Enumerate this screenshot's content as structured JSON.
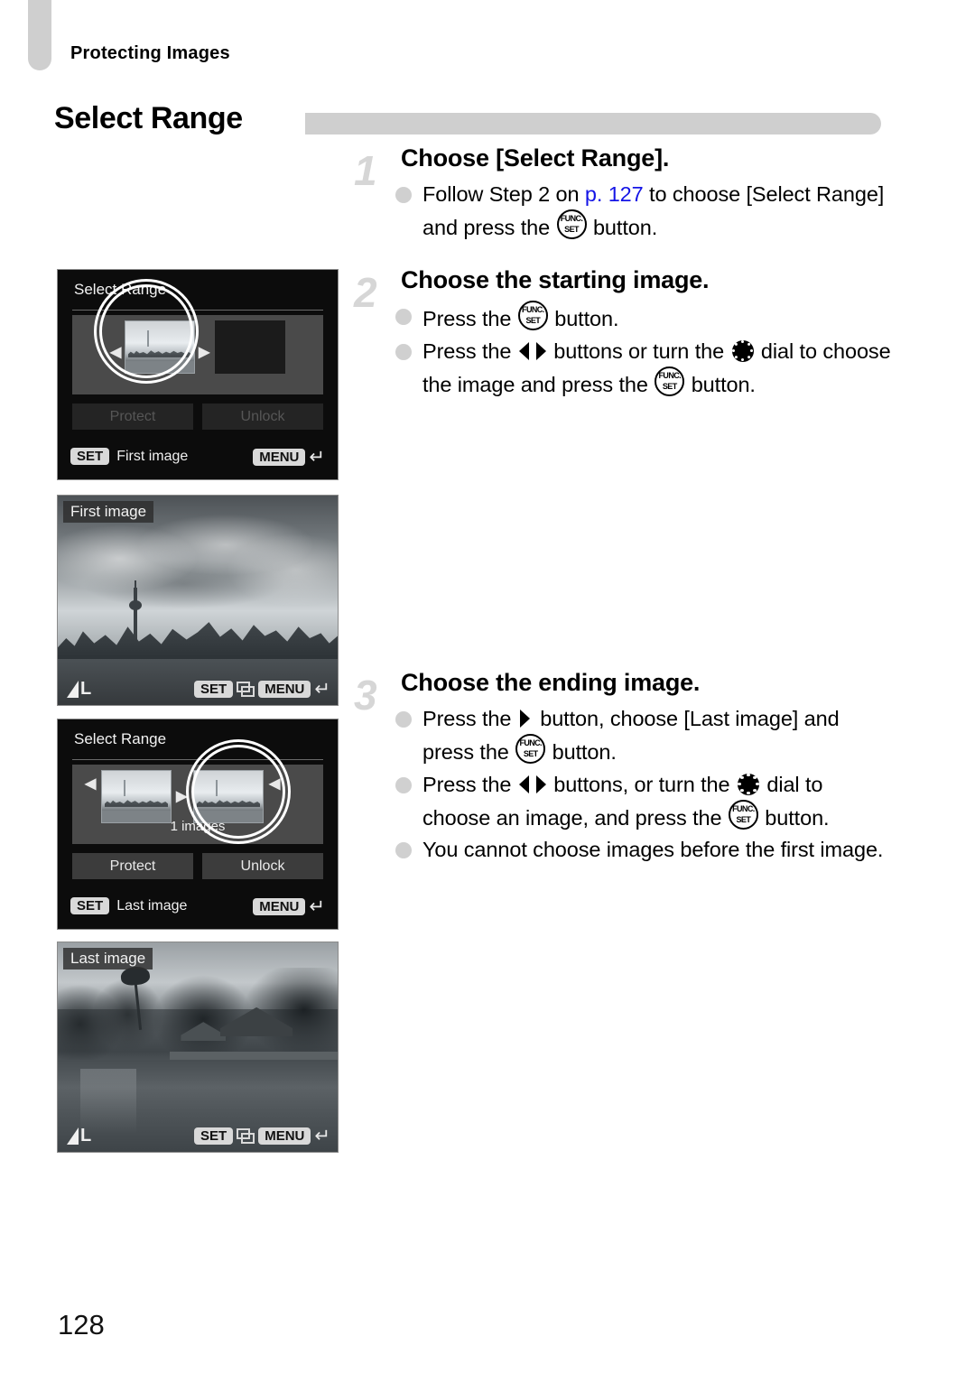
{
  "page": {
    "running_head": "Protecting Images",
    "section_title": "Select Range",
    "page_number": "128"
  },
  "steps": [
    {
      "number": "1",
      "heading": "Choose [Select Range].",
      "bullets": [
        {
          "segments": [
            {
              "type": "text",
              "value": "Follow Step 2 on "
            },
            {
              "type": "link",
              "value": "p. 127"
            },
            {
              "type": "text",
              "value": " to choose [Select Range] and press the "
            },
            {
              "type": "icon",
              "value": "func-set-icon"
            },
            {
              "type": "text",
              "value": " button."
            }
          ]
        }
      ]
    },
    {
      "number": "2",
      "heading": "Choose the starting image.",
      "bullets": [
        {
          "segments": [
            {
              "type": "text",
              "value": "Press the "
            },
            {
              "type": "icon",
              "value": "func-set-icon"
            },
            {
              "type": "text",
              "value": " button."
            }
          ]
        },
        {
          "segments": [
            {
              "type": "text",
              "value": "Press the "
            },
            {
              "type": "icon",
              "value": "left-right-buttons-icon"
            },
            {
              "type": "text",
              "value": " buttons or turn the "
            },
            {
              "type": "icon",
              "value": "control-dial-icon"
            },
            {
              "type": "text",
              "value": " dial to choose the image and press the "
            },
            {
              "type": "icon",
              "value": "func-set-icon"
            },
            {
              "type": "text",
              "value": " button."
            }
          ]
        }
      ]
    },
    {
      "number": "3",
      "heading": "Choose the ending image.",
      "bullets": [
        {
          "segments": [
            {
              "type": "text",
              "value": "Press the "
            },
            {
              "type": "icon",
              "value": "right-button-icon"
            },
            {
              "type": "text",
              "value": " button, choose [Last image] and press the "
            },
            {
              "type": "icon",
              "value": "func-set-icon"
            },
            {
              "type": "text",
              "value": " button."
            }
          ]
        },
        {
          "segments": [
            {
              "type": "text",
              "value": "Press the "
            },
            {
              "type": "icon",
              "value": "left-right-buttons-icon"
            },
            {
              "type": "text",
              "value": " buttons, or turn the "
            },
            {
              "type": "icon",
              "value": "control-dial-icon"
            },
            {
              "type": "text",
              "value": " dial to choose an image, and press the "
            },
            {
              "type": "icon",
              "value": "func-set-icon"
            },
            {
              "type": "text",
              "value": " button."
            }
          ]
        },
        {
          "segments": [
            {
              "type": "text",
              "value": "You cannot choose images before the first image."
            }
          ]
        }
      ]
    }
  ],
  "screens": {
    "select_range_first": {
      "title": "Select Range",
      "left_arrow": "◀",
      "right_arrow": "▶",
      "protect_label": "Protect",
      "unlock_label": "Unlock",
      "set_badge": "SET",
      "set_action": "First image",
      "menu_badge": "MENU",
      "back_arrow": "↵"
    },
    "first_image": {
      "tag": "First image",
      "quality": "L",
      "set_badge": "SET",
      "menu_badge": "MENU",
      "back_arrow": "↵"
    },
    "select_range_last": {
      "title": "Select Range",
      "left_arrow": "◀",
      "right_arrow": "▶",
      "count_label": "1 images",
      "protect_label": "Protect",
      "unlock_label": "Unlock",
      "set_badge": "SET",
      "set_action": "Last image",
      "menu_badge": "MENU",
      "back_arrow": "↵"
    },
    "last_image": {
      "tag": "Last image",
      "quality": "L",
      "set_badge": "SET",
      "menu_badge": "MENU",
      "back_arrow": "↵"
    }
  },
  "colors": {
    "accent_gray": "#cfcfcf",
    "link_blue": "#1414e6",
    "bullet_gray": "#d0d0d0",
    "step_number_gray": "#d6d6d6"
  }
}
